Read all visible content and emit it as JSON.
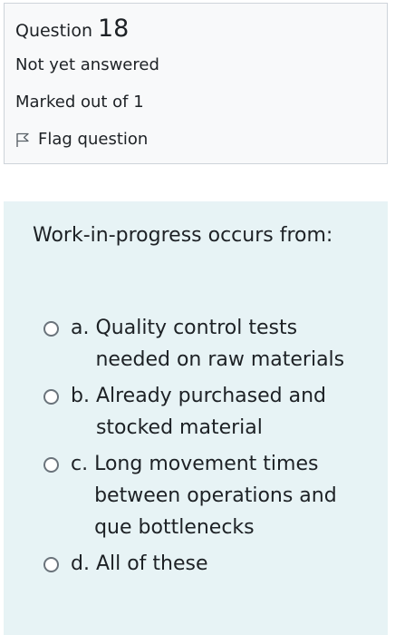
{
  "info": {
    "question_label": "Question",
    "question_number": "18",
    "state": "Not yet answered",
    "grade": "Marked out of 1",
    "flag_label": "Flag question"
  },
  "question": {
    "text": "Work-in-progress occurs from:",
    "options": [
      {
        "letter": "a. ",
        "text": "Quality control tests needed on raw materials"
      },
      {
        "letter": "b. ",
        "text": "Already purchased and stocked material"
      },
      {
        "letter": "c. ",
        "text": "Long movement times between operations and que bottlenecks"
      },
      {
        "letter": "d. ",
        "text": "All of these"
      }
    ]
  },
  "colors": {
    "info_bg": "#f8f9fa",
    "info_border": "#ced4da",
    "content_bg": "#e7f3f5"
  },
  "icons": {
    "flag": "flag-outline-icon"
  }
}
